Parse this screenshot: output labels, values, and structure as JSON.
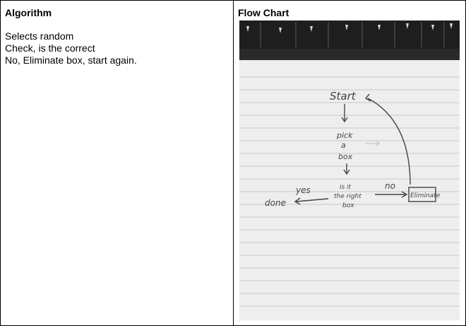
{
  "algorithm": {
    "heading": "Algorithm",
    "lines": [
      "Selects random",
      "Check, is the correct",
      "No, Eliminate box, start again."
    ]
  },
  "flowchart": {
    "heading": "Flow Chart",
    "photo": {
      "start": "Start",
      "pick_1": "pick",
      "pick_2": "a",
      "pick_3": "box",
      "q_1": "is it",
      "q_2": "the right",
      "q_3": "box",
      "yes": "yes",
      "no": "no",
      "done": "done",
      "eliminate": "Eliminate"
    }
  }
}
